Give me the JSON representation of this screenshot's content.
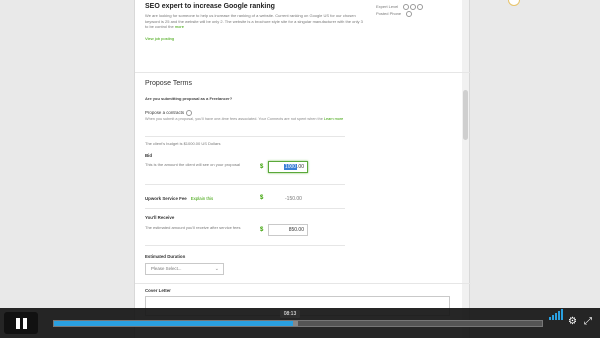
{
  "job": {
    "title": "SEO expert to increase Google ranking",
    "description": "We are looking for someone to help us increase the ranking of a website. Current ranking on Google US for our chosen keyword is 25 and the website will be only 2. The website is a brochure style site for a singular manufacturer with the only 3 to be control the",
    "more_label": "more",
    "view_link": "View job posting",
    "meta_level": "Expert Level",
    "meta_posted": "Posted Phone"
  },
  "propose": {
    "section_title": "Propose Terms",
    "question": "Are you submitting proposal as a Freelancer?",
    "radio_label": "Propose a contracts",
    "radio_help": "When you submit a proposal, you'll have one-time fees associated. Your Connects are not spent when the",
    "learn_more": "Learn more",
    "budget_note": "The client's budget is $1000.00 US Dollars"
  },
  "bid": {
    "label": "Bid",
    "help": "This is the amount the client will see on your proposal",
    "currency": "$",
    "value_selected": "1000",
    "value_rest": ".00"
  },
  "fee": {
    "label": "Upwork Service Fee",
    "explain": "Explain this",
    "currency": "$",
    "value": "-150.00"
  },
  "receive": {
    "label": "You'll Receive",
    "help": "The estimated amount you'll receive after service fees",
    "currency": "$",
    "value": "850.00"
  },
  "duration": {
    "label": "Estimated Duration",
    "placeholder": "Please Select...",
    "chevron": "⌄"
  },
  "cover": {
    "label": "Cover Letter"
  },
  "player": {
    "time_tip": "08:13",
    "progress_played": 0.49,
    "progress_buffered": 0.5,
    "gear_icon": "⚙",
    "fullscreen_icon": "⤢"
  }
}
